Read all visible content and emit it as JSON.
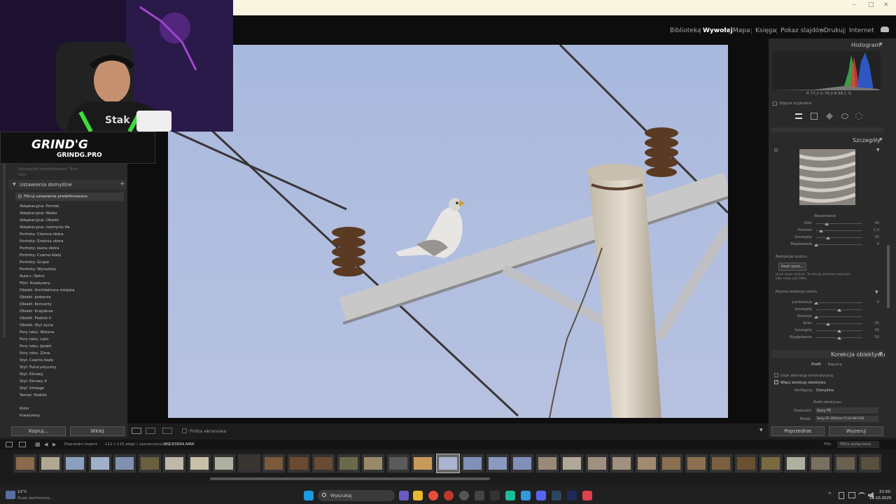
{
  "window": {
    "minimize": "–",
    "maximize": "□",
    "close": "×"
  },
  "modules": [
    "Biblioteka",
    "Wywołaj",
    "Mapa",
    "Księga",
    "Pokaz slajdów",
    "Drukuj",
    "Internet"
  ],
  "webcam": {
    "shirt_text": "Stak"
  },
  "overlay": {
    "brand": "GRIND'G",
    "site": "GRINDG.PRO"
  },
  "left_panel": {
    "faded_line1": "Szczególnie predefiniowane",
    "faded_line1_b": "Brak",
    "faded_line2": "Ilość",
    "section": "Ustawienia domyślne",
    "filter_label": "Filtruj ustawienia predefiniowane",
    "presets": [
      "Adaptacyjna: Portret",
      "Adaptacyjna: Niebo",
      "Adaptacyjna: Obiekt",
      "Adaptacyjna: rozmycie tła",
      "Portrety: Ciemna skóra",
      "Portrety: Średnia skóra",
      "Portrety: Jasna skóra",
      "Portrety: Czarno-biały",
      "Portrety: Grupa",
      "Portrety: Wyrazisty",
      "Auto+: Retro",
      "Film: Kreatywny",
      "Obiekt: Architektura miejska",
      "Obiekt: Jedzenie",
      "Obiekt: Koncerty",
      "Obiekt: Krajobraz",
      "Obiekt: Podróż II",
      "Obiekt: Styl życia",
      "Pory roku: Wiosna",
      "Pory roku: Lato",
      "Pory roku: Jesień",
      "Pory roku: Zima",
      "Styl: Czarno-biały",
      "Styl: Futurystyczny",
      "Styl: Kinowy",
      "Styl: Kinowy II",
      "Styl: Vintage",
      "Temat: Podróż"
    ],
    "presets2": [
      "Kolor",
      "Kreatywny"
    ],
    "copy_button": "Kopiuj...",
    "paste_button": "Wklej"
  },
  "right_panel": {
    "histogram_title": "Histogram",
    "histogram_readout": "R 77,2 G 78,0 B 88,1 %",
    "original_photo": "Zdjęcie oryginalne",
    "details_title": "Szczegóły",
    "sharpening_title": "Wyostrzanie",
    "sharpening_sliders": [
      {
        "label": "Ilość",
        "value": "40",
        "pos": 0.23
      },
      {
        "label": "Promień",
        "value": "1,0",
        "pos": 0.1
      },
      {
        "label": "Szczegóły",
        "value": "25",
        "pos": 0.25
      },
      {
        "label": "Maskowanie",
        "value": "0",
        "pos": 0.0
      }
    ],
    "noise_title": "Redukcja szumu",
    "denoise_button": "Usuń szum...",
    "denoise_note": "Usuń szum zdjęcia. Ta wersja zostanie zapisana jako nowy plik DNG.",
    "manual_noise": "Ręczna redukcja szumu",
    "manual_sliders": [
      {
        "label": "Luminancja",
        "value": "0",
        "pos": 0.0
      },
      {
        "label": "Szczegóły",
        "value": "",
        "pos": 0.5
      },
      {
        "label": "Kontrast",
        "value": "",
        "pos": 0.0
      },
      {
        "label": "Kolor",
        "value": "25",
        "pos": 0.25
      },
      {
        "label": "Szczegóły",
        "value": "50",
        "pos": 0.5
      },
      {
        "label": "Wygładzanie",
        "value": "50",
        "pos": 0.5
      }
    ],
    "lens_title": "Korekcja obiektywu",
    "lens_tabs": [
      "Profil",
      "Ręczny"
    ],
    "lens_checks": [
      "Usuń aberrację chromatyczną",
      "Włącz korekcję obiektywu"
    ],
    "config_label": "Konfiguruj",
    "config_value": "Domyślne",
    "lens_profile": "Profil obiektywu",
    "maker_label": "Producent",
    "maker_value": "Sony FE",
    "model_label": "Model",
    "model_value": "Sony FE 400mm F2.8 GM OSS",
    "prev_button": "Poprzednie",
    "reset_button": "Wyzeruj"
  },
  "toolbar": {
    "proof": "Próba ekranowa"
  },
  "filmstrip": {
    "source": "Poprzedni import",
    "count": "112 z 115 zdjęć / zaznaczonych: 1 /",
    "filename": "DSC03694.ARW",
    "filter_label": "Filtr:",
    "filter_value": "Filtry wyłączone",
    "thumb_colors": [
      "#8a6a4a",
      "#b0a890",
      "#8aa0c0",
      "#a0b0c8",
      "#8090b0",
      "#6a6040",
      "#c0b8a8",
      "#c8c0a8",
      "#b0b0a0",
      "#3a3530",
      "#7a5a3a",
      "#6a4a30",
      "#6a4a30",
      "#6a6a4a",
      "#9a8a6a",
      "#5a5a5a",
      "#c89a5a",
      "#a8b4d0",
      "#8090b8",
      "#8a9ac0",
      "#8090b8",
      "#9a8a7a",
      "#b0a898",
      "#a09080",
      "#a09080",
      "#a08a70",
      "#8a7050",
      "#8a7050",
      "#7a6040",
      "#6a5030",
      "#7a6a40",
      "#b0b0a0",
      "#7a7060",
      "#6a6050",
      "#5a5040"
    ]
  },
  "taskbar": {
    "weather_temp": "12°C",
    "weather_desc": "Duże zachmurze...",
    "search": "Wyszukaj",
    "time": "21:50",
    "date": "12.10.2025"
  }
}
